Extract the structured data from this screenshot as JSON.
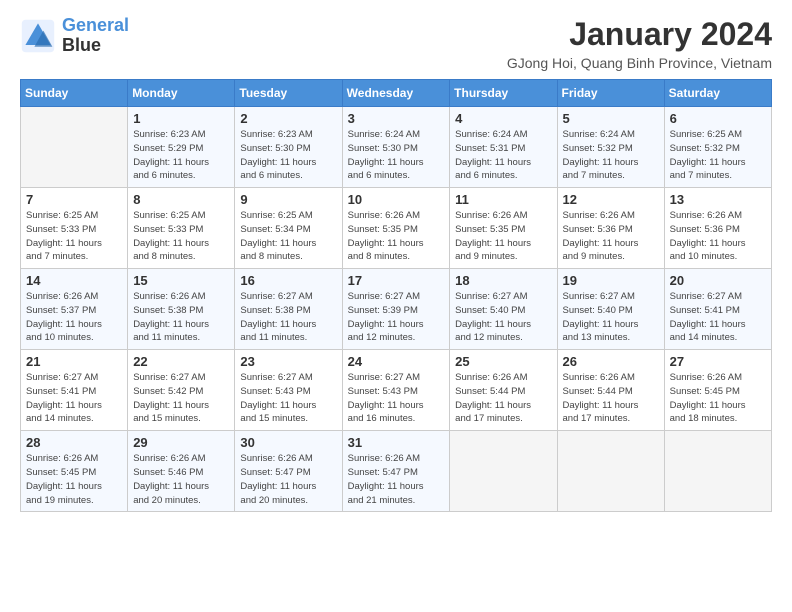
{
  "header": {
    "logo_line1": "General",
    "logo_line2": "Blue",
    "month": "January 2024",
    "location": "GJong Hoi, Quang Binh Province, Vietnam"
  },
  "days_of_week": [
    "Sunday",
    "Monday",
    "Tuesday",
    "Wednesday",
    "Thursday",
    "Friday",
    "Saturday"
  ],
  "weeks": [
    [
      {
        "day": "",
        "info": ""
      },
      {
        "day": "1",
        "info": "Sunrise: 6:23 AM\nSunset: 5:29 PM\nDaylight: 11 hours\nand 6 minutes."
      },
      {
        "day": "2",
        "info": "Sunrise: 6:23 AM\nSunset: 5:30 PM\nDaylight: 11 hours\nand 6 minutes."
      },
      {
        "day": "3",
        "info": "Sunrise: 6:24 AM\nSunset: 5:30 PM\nDaylight: 11 hours\nand 6 minutes."
      },
      {
        "day": "4",
        "info": "Sunrise: 6:24 AM\nSunset: 5:31 PM\nDaylight: 11 hours\nand 6 minutes."
      },
      {
        "day": "5",
        "info": "Sunrise: 6:24 AM\nSunset: 5:32 PM\nDaylight: 11 hours\nand 7 minutes."
      },
      {
        "day": "6",
        "info": "Sunrise: 6:25 AM\nSunset: 5:32 PM\nDaylight: 11 hours\nand 7 minutes."
      }
    ],
    [
      {
        "day": "7",
        "info": "Sunrise: 6:25 AM\nSunset: 5:33 PM\nDaylight: 11 hours\nand 7 minutes."
      },
      {
        "day": "8",
        "info": "Sunrise: 6:25 AM\nSunset: 5:33 PM\nDaylight: 11 hours\nand 8 minutes."
      },
      {
        "day": "9",
        "info": "Sunrise: 6:25 AM\nSunset: 5:34 PM\nDaylight: 11 hours\nand 8 minutes."
      },
      {
        "day": "10",
        "info": "Sunrise: 6:26 AM\nSunset: 5:35 PM\nDaylight: 11 hours\nand 8 minutes."
      },
      {
        "day": "11",
        "info": "Sunrise: 6:26 AM\nSunset: 5:35 PM\nDaylight: 11 hours\nand 9 minutes."
      },
      {
        "day": "12",
        "info": "Sunrise: 6:26 AM\nSunset: 5:36 PM\nDaylight: 11 hours\nand 9 minutes."
      },
      {
        "day": "13",
        "info": "Sunrise: 6:26 AM\nSunset: 5:36 PM\nDaylight: 11 hours\nand 10 minutes."
      }
    ],
    [
      {
        "day": "14",
        "info": "Sunrise: 6:26 AM\nSunset: 5:37 PM\nDaylight: 11 hours\nand 10 minutes."
      },
      {
        "day": "15",
        "info": "Sunrise: 6:26 AM\nSunset: 5:38 PM\nDaylight: 11 hours\nand 11 minutes."
      },
      {
        "day": "16",
        "info": "Sunrise: 6:27 AM\nSunset: 5:38 PM\nDaylight: 11 hours\nand 11 minutes."
      },
      {
        "day": "17",
        "info": "Sunrise: 6:27 AM\nSunset: 5:39 PM\nDaylight: 11 hours\nand 12 minutes."
      },
      {
        "day": "18",
        "info": "Sunrise: 6:27 AM\nSunset: 5:40 PM\nDaylight: 11 hours\nand 12 minutes."
      },
      {
        "day": "19",
        "info": "Sunrise: 6:27 AM\nSunset: 5:40 PM\nDaylight: 11 hours\nand 13 minutes."
      },
      {
        "day": "20",
        "info": "Sunrise: 6:27 AM\nSunset: 5:41 PM\nDaylight: 11 hours\nand 14 minutes."
      }
    ],
    [
      {
        "day": "21",
        "info": "Sunrise: 6:27 AM\nSunset: 5:41 PM\nDaylight: 11 hours\nand 14 minutes."
      },
      {
        "day": "22",
        "info": "Sunrise: 6:27 AM\nSunset: 5:42 PM\nDaylight: 11 hours\nand 15 minutes."
      },
      {
        "day": "23",
        "info": "Sunrise: 6:27 AM\nSunset: 5:43 PM\nDaylight: 11 hours\nand 15 minutes."
      },
      {
        "day": "24",
        "info": "Sunrise: 6:27 AM\nSunset: 5:43 PM\nDaylight: 11 hours\nand 16 minutes."
      },
      {
        "day": "25",
        "info": "Sunrise: 6:26 AM\nSunset: 5:44 PM\nDaylight: 11 hours\nand 17 minutes."
      },
      {
        "day": "26",
        "info": "Sunrise: 6:26 AM\nSunset: 5:44 PM\nDaylight: 11 hours\nand 17 minutes."
      },
      {
        "day": "27",
        "info": "Sunrise: 6:26 AM\nSunset: 5:45 PM\nDaylight: 11 hours\nand 18 minutes."
      }
    ],
    [
      {
        "day": "28",
        "info": "Sunrise: 6:26 AM\nSunset: 5:45 PM\nDaylight: 11 hours\nand 19 minutes."
      },
      {
        "day": "29",
        "info": "Sunrise: 6:26 AM\nSunset: 5:46 PM\nDaylight: 11 hours\nand 20 minutes."
      },
      {
        "day": "30",
        "info": "Sunrise: 6:26 AM\nSunset: 5:47 PM\nDaylight: 11 hours\nand 20 minutes."
      },
      {
        "day": "31",
        "info": "Sunrise: 6:26 AM\nSunset: 5:47 PM\nDaylight: 11 hours\nand 21 minutes."
      },
      {
        "day": "",
        "info": ""
      },
      {
        "day": "",
        "info": ""
      },
      {
        "day": "",
        "info": ""
      }
    ]
  ]
}
